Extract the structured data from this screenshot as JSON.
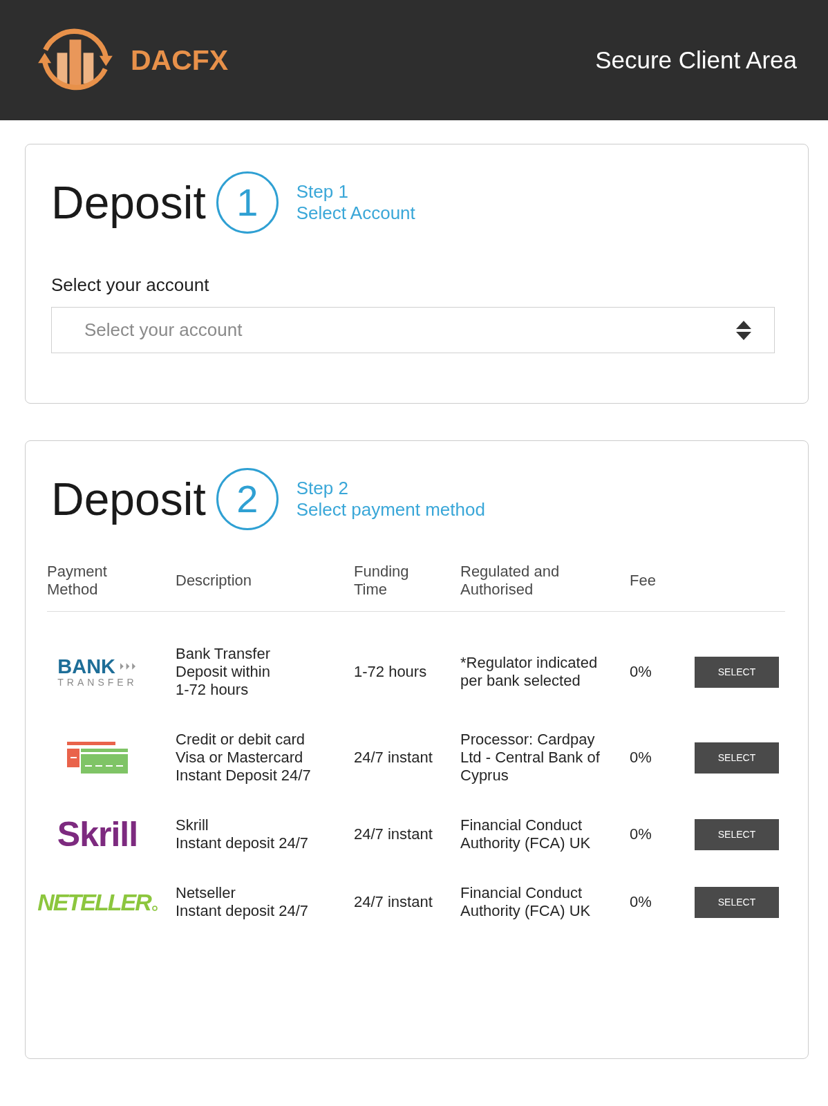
{
  "header": {
    "logo_text": "DACFX",
    "title": "Secure Client Area"
  },
  "account_step": {
    "heading": "Deposit",
    "number": "1",
    "step_label": "Step 1",
    "step_title": "Select Account",
    "field_label": "Select your account",
    "account_select": {
      "placeholder": "Select your account"
    }
  },
  "payment_step": {
    "heading": "Deposit",
    "number": "2",
    "step_label": "Step 2",
    "step_title": "Select payment method",
    "table": {
      "columns": [
        [
          "Payment",
          "Method"
        ],
        [
          "Description"
        ],
        [
          "Funding",
          "Time"
        ],
        [
          "Regulated and",
          "Authorised"
        ],
        [
          "Fee"
        ]
      ],
      "rows": [
        {
          "method": {
            "kind": "bank",
            "logo_text": "BANK",
            "logo_subtext": "TRANSFER"
          },
          "description": [
            "Bank Transfer",
            "Deposit within",
            "1-72 hours"
          ],
          "funding_time": "1-72 hours",
          "regulated": [
            "*Regulator indicated",
            "per bank selected"
          ],
          "fee": "0%",
          "action": "SELECT"
        },
        {
          "method": {
            "kind": "card"
          },
          "description": [
            "Credit or debit card",
            "Visa or Mastercard",
            "Instant Deposit 24/7"
          ],
          "funding_time": "24/7 instant",
          "regulated": [
            "Processor: Cardpay",
            "Ltd - Central Bank of",
            "Cyprus"
          ],
          "fee": "0%",
          "action": "SELECT"
        },
        {
          "method": {
            "kind": "skrill",
            "logo_text": "Skrill"
          },
          "description": [
            "Skrill",
            "Instant deposit 24/7"
          ],
          "funding_time": "24/7 instant",
          "regulated": [
            "Financial Conduct",
            "Authority (FCA) UK"
          ],
          "fee": "0%",
          "action": "SELECT"
        },
        {
          "method": {
            "kind": "neteller",
            "logo_text": "NETELLER"
          },
          "description": [
            "Netseller",
            "Instant deposit 24/7"
          ],
          "funding_time": "24/7 instant",
          "regulated": [
            "Financial Conduct",
            "Authority (FCA) UK"
          ],
          "fee": "0%",
          "action": "SELECT"
        }
      ]
    }
  }
}
